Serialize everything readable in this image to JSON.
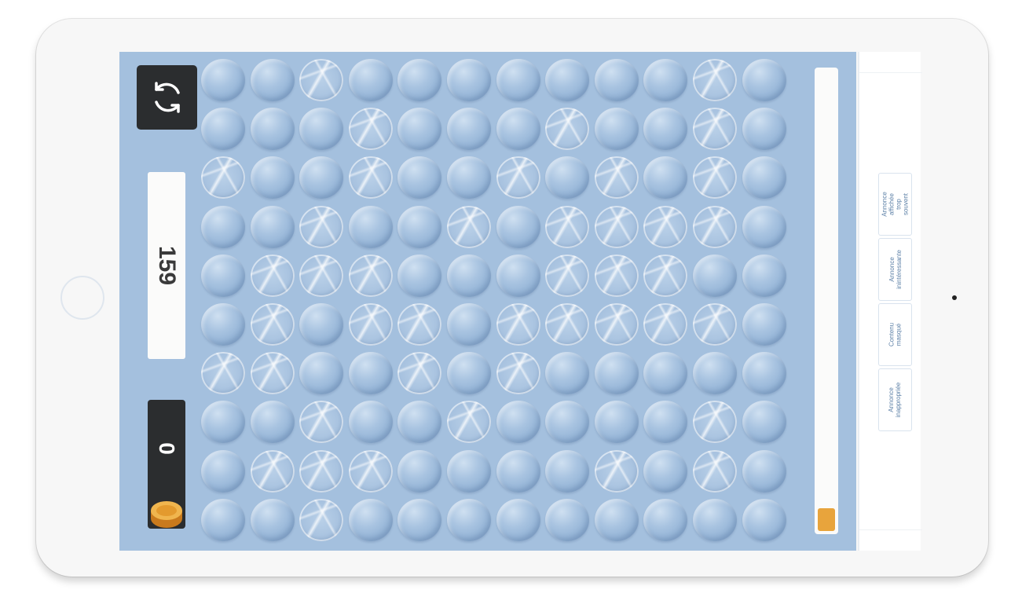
{
  "game": {
    "score": "159",
    "coins": "0",
    "progress_fraction": 0.05,
    "refresh_icon": "refresh-icon",
    "coin_icon": "coin-icon",
    "colors": {
      "background": "#a4c0de",
      "panel_dark": "#2b2d2f",
      "progress": "#e8a43c"
    }
  },
  "bubble_grid": {
    "rows": 10,
    "cols": 12,
    "popped": [
      [
        0,
        2
      ],
      [
        0,
        10
      ],
      [
        1,
        3
      ],
      [
        1,
        7
      ],
      [
        1,
        10
      ],
      [
        2,
        0
      ],
      [
        2,
        3
      ],
      [
        2,
        6
      ],
      [
        2,
        8
      ],
      [
        2,
        10
      ],
      [
        3,
        2
      ],
      [
        3,
        5
      ],
      [
        3,
        7
      ],
      [
        3,
        8
      ],
      [
        3,
        9
      ],
      [
        3,
        10
      ],
      [
        4,
        1
      ],
      [
        4,
        2
      ],
      [
        4,
        3
      ],
      [
        4,
        7
      ],
      [
        4,
        8
      ],
      [
        4,
        9
      ],
      [
        5,
        1
      ],
      [
        5,
        3
      ],
      [
        5,
        4
      ],
      [
        5,
        6
      ],
      [
        5,
        7
      ],
      [
        5,
        8
      ],
      [
        5,
        9
      ],
      [
        5,
        10
      ],
      [
        6,
        0
      ],
      [
        6,
        1
      ],
      [
        6,
        4
      ],
      [
        6,
        6
      ],
      [
        7,
        2
      ],
      [
        7,
        5
      ],
      [
        7,
        10
      ],
      [
        8,
        1
      ],
      [
        8,
        2
      ],
      [
        8,
        3
      ],
      [
        8,
        8
      ],
      [
        8,
        10
      ],
      [
        9,
        2
      ]
    ]
  },
  "ad_feedback": {
    "options": [
      {
        "label": "Annonce affichée trop souvent"
      },
      {
        "label": "Annonce inintéressante"
      },
      {
        "label": "Contenu masqué"
      },
      {
        "label": "Annonce inappropriée"
      }
    ]
  }
}
